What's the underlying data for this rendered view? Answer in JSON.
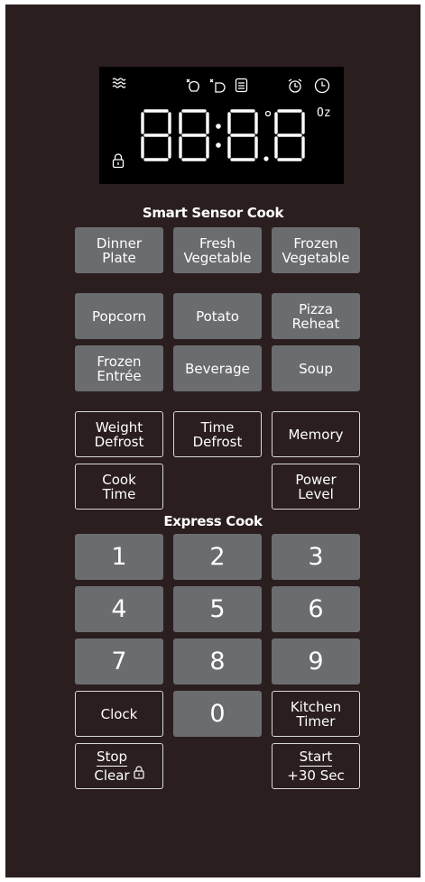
{
  "display": {
    "digits": "88:8.8",
    "unit": "Oz",
    "icons": [
      "steam-icon",
      "defrost-food-icon",
      "sensor-reheat-icon",
      "menu-list-icon",
      "timer-alarm-icon",
      "clock-icon",
      "child-lock-icon",
      "degree-dot-icon"
    ]
  },
  "smart_sensor": {
    "title": "Smart Sensor Cook",
    "dinner_plate": "Dinner\nPlate",
    "fresh_vegetable": "Fresh\nVegetable",
    "frozen_vegetable": "Frozen\nVegetable",
    "popcorn": "Popcorn",
    "potato": "Potato",
    "pizza_reheat": "Pizza\nReheat",
    "frozen_entree": "Frozen\nEntrée",
    "beverage": "Beverage",
    "soup": "Soup"
  },
  "controls": {
    "weight_defrost": "Weight\nDefrost",
    "time_defrost": "Time\nDefrost",
    "memory": "Memory",
    "cook_time": "Cook\nTime",
    "power_level": "Power\nLevel"
  },
  "express": {
    "title": "Express Cook",
    "keys": [
      "1",
      "2",
      "3",
      "4",
      "5",
      "6",
      "7",
      "8",
      "9"
    ],
    "zero": "0"
  },
  "bottom": {
    "clock": "Clock",
    "kitchen_timer": "Kitchen\nTimer",
    "stop": "Stop",
    "clear": "Clear",
    "start": "Start",
    "plus30": "+30 Sec"
  },
  "colors": {
    "panel": "#2a1e1f",
    "button_grey": "#6b6c70",
    "display_bg": "#000000",
    "text": "#ffffff"
  }
}
